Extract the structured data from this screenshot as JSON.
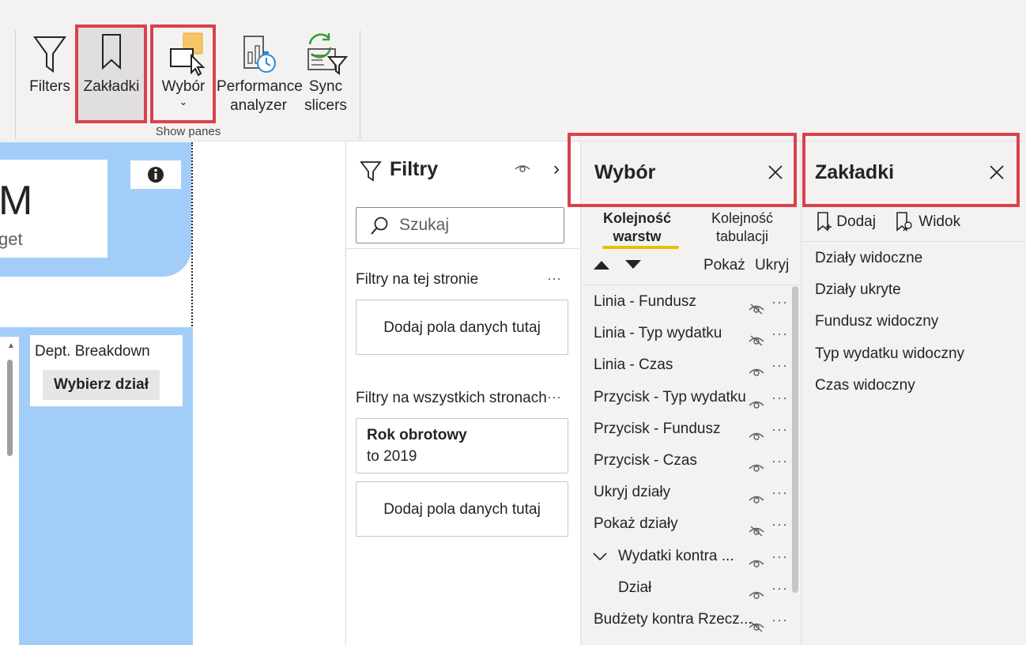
{
  "ribbon": {
    "buttons": [
      {
        "label": "Filters",
        "icon": "filter-icon"
      },
      {
        "label": "Zakładki",
        "icon": "bookmark-icon"
      },
      {
        "label": "Wybór",
        "icon": "selection-icon"
      },
      {
        "label_line1": "Performance",
        "label_line2": "analyzer",
        "icon": "performance-analyzer-icon"
      },
      {
        "label_line1": "Sync",
        "label_line2": "slicers",
        "icon": "sync-slicers-icon"
      }
    ],
    "group_label": "Show panes",
    "highlight_color": "#d9414d"
  },
  "canvas": {
    "card_big_text": "M",
    "card_sub_text": "get",
    "dept_title": "Dept. Breakdown",
    "dept_button": "Wybierz dział",
    "visual_fill_color": "#a2cdf8"
  },
  "filters": {
    "title": "Filtry",
    "search_placeholder": "Szukaj",
    "page_section": "Filtry na tej stronie",
    "page_drop": "Dodaj pola danych tutaj",
    "all_section": "Filtry na wszystkich stronach",
    "active_filter_name": "Rok obrotowy",
    "active_filter_value": "to 2019",
    "all_drop": "Dodaj pola danych tutaj",
    "more": "···"
  },
  "selection": {
    "title": "Wybór",
    "tab_layer_line1": "Kolejność",
    "tab_layer_line2": "warstw",
    "tab_tab_line1": "Kolejność",
    "tab_tab_line2": "tabulacji",
    "show": "Pokaż",
    "hide": "Ukryj",
    "accent_color": "#e8c000",
    "items": [
      {
        "label": "Linia - Fundusz",
        "visible": false
      },
      {
        "label": "Linia - Typ wydatku",
        "visible": false
      },
      {
        "label": "Linia - Czas",
        "visible": true
      },
      {
        "label": "Przycisk - Typ wydatku",
        "visible": true
      },
      {
        "label": "Przycisk - Fundusz",
        "visible": true
      },
      {
        "label": "Przycisk - Czas",
        "visible": true
      },
      {
        "label": "Ukryj działy",
        "visible": true
      },
      {
        "label": "Pokaż działy",
        "visible": false
      },
      {
        "label": "Wydatki kontra ...",
        "visible": true,
        "group": true
      },
      {
        "label": "Dział",
        "visible": true,
        "child": true
      },
      {
        "label": "Budżety kontra Rzecz...",
        "visible": false
      }
    ],
    "more": "···"
  },
  "bookmarks": {
    "title": "Zakładki",
    "add": "Dodaj",
    "view": "Widok",
    "items": [
      "Działy widoczne",
      "Działy ukryte",
      "Fundusz widoczny",
      "Typ wydatku widoczny",
      "Czas widoczny"
    ]
  }
}
